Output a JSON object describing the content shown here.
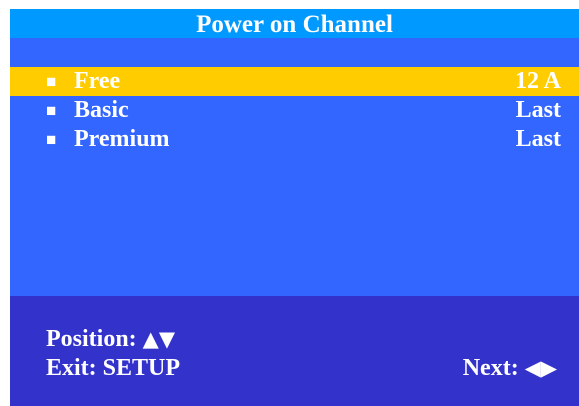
{
  "title": "Power on Channel",
  "bullet_glyph": "■",
  "menu_items": [
    {
      "label": "Free",
      "value": "12 A",
      "selected": true
    },
    {
      "label": "Basic",
      "value": "Last",
      "selected": false
    },
    {
      "label": "Premium",
      "value": "Last",
      "selected": false
    }
  ],
  "footer": {
    "position_label": "Position:",
    "position_arrows": "▲▼",
    "exit_label": "Exit: SETUP",
    "next_label": "Next:",
    "next_arrows": "◀▶"
  },
  "colors": {
    "title_bar": "#0099ff",
    "menu_background": "#3366ff",
    "selection_highlight": "#ffcc00",
    "footer_background": "#3333cc",
    "text": "#ffffff"
  }
}
